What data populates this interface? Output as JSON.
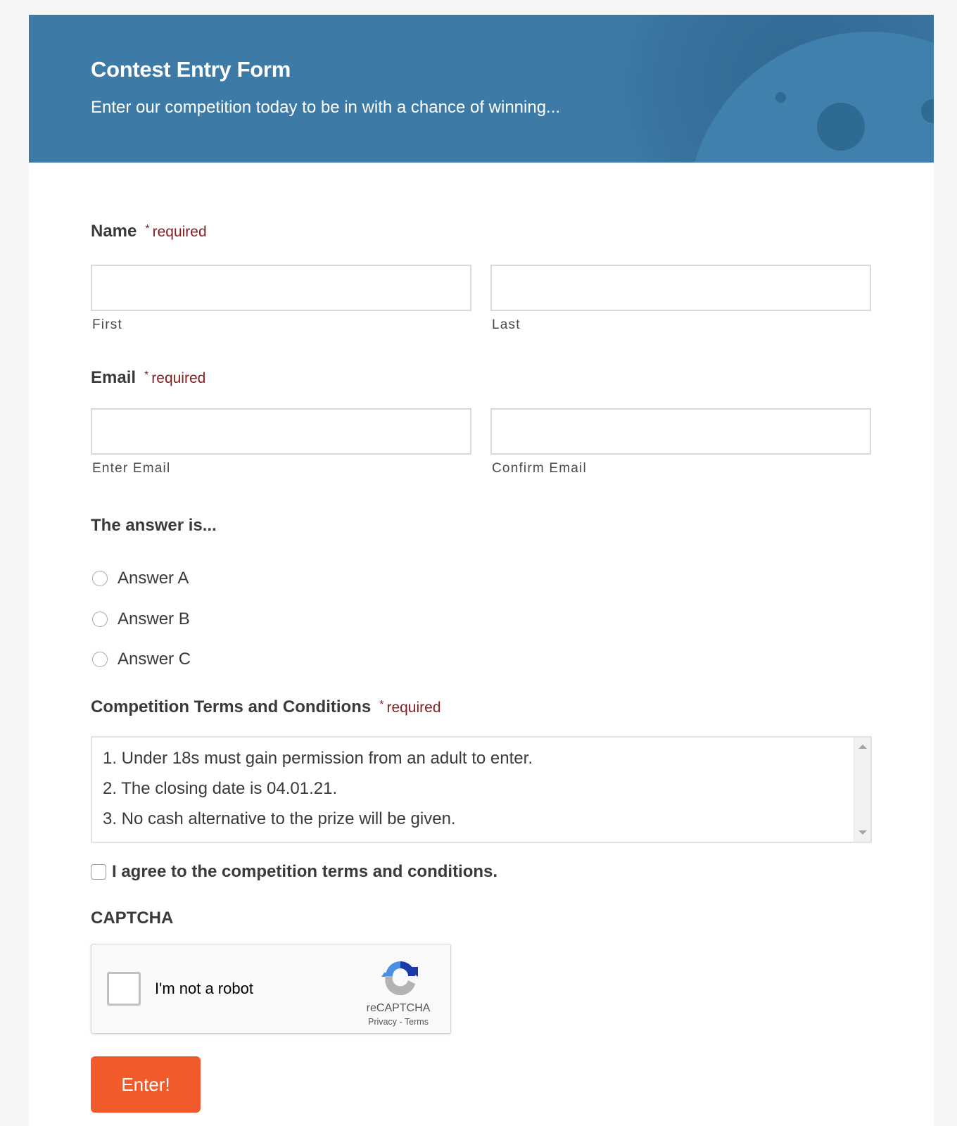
{
  "header": {
    "title": "Contest Entry Form",
    "description": "Enter our competition today to be in with a chance of winning...",
    "background_color": "#3d7aa6"
  },
  "required_text": "required",
  "required_star": "*",
  "name_field": {
    "label": "Name",
    "required": true,
    "first": {
      "value": "",
      "sublabel": "First"
    },
    "last": {
      "value": "",
      "sublabel": "Last"
    }
  },
  "email_field": {
    "label": "Email",
    "required": true,
    "enter": {
      "value": "",
      "sublabel": "Enter Email"
    },
    "confirm": {
      "value": "",
      "sublabel": "Confirm Email"
    }
  },
  "answer_field": {
    "label": "The answer is...",
    "options": [
      {
        "label": "Answer A",
        "selected": false
      },
      {
        "label": "Answer B",
        "selected": false
      },
      {
        "label": "Answer C",
        "selected": false
      }
    ]
  },
  "terms_field": {
    "label": "Competition Terms and Conditions",
    "required": true,
    "lines": [
      "1. Under 18s must gain permission from an adult to enter.",
      "2. The closing date is 04.01.21.",
      "3. No cash alternative to the prize will be given."
    ],
    "agree_label": "I agree to the competition terms and conditions.",
    "agree_checked": false
  },
  "captcha": {
    "title": "CAPTCHA",
    "checkbox_label": "I'm not a robot",
    "checked": false,
    "brand": "reCAPTCHA",
    "privacy_link": "Privacy",
    "separator": "-",
    "terms_link": "Terms"
  },
  "submit": {
    "label": "Enter!",
    "color": "#f15a2b"
  },
  "colors": {
    "required": "#8a1c1c",
    "page_background": "#f6f6f6"
  }
}
